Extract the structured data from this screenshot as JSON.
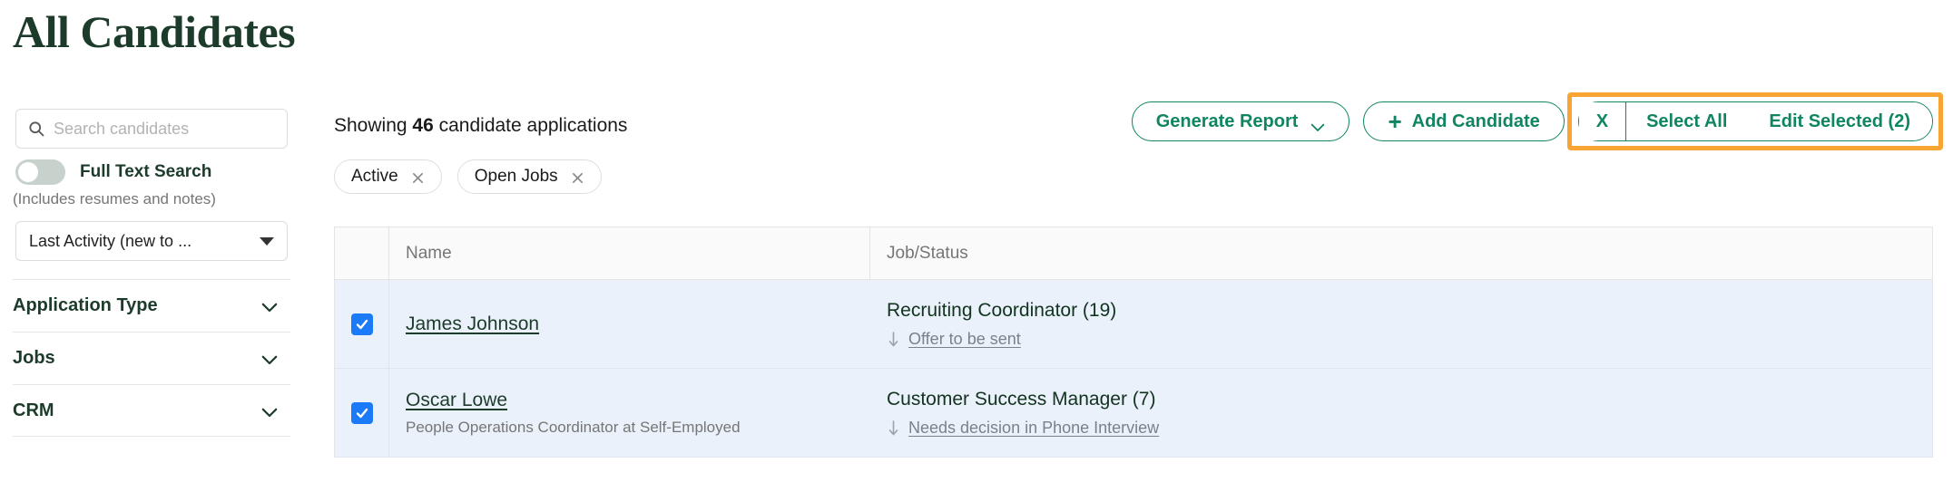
{
  "page_title": "All Candidates",
  "sidebar": {
    "search": {
      "placeholder": "Search candidates",
      "value": "",
      "icon": "search-icon"
    },
    "full_text_toggle": {
      "label": "Full Text Search",
      "sublabel": "(Includes resumes and notes)",
      "state": "off"
    },
    "sort": {
      "selected": "Last Activity (new to ...",
      "icon": "chevron-down-icon"
    },
    "filter_sections": [
      {
        "label": "Application Type",
        "icon": "chevron-down-icon",
        "expanded": false
      },
      {
        "label": "Jobs",
        "icon": "chevron-down-icon",
        "expanded": false
      },
      {
        "label": "CRM",
        "icon": "chevron-down-icon",
        "expanded": false
      }
    ]
  },
  "main": {
    "showing_prefix": "Showing",
    "showing_count": "46",
    "showing_suffix": "candidate applications",
    "actions": {
      "generate_report": "Generate Report",
      "generate_report_icon": "chevron-down-icon",
      "add_candidate": "Add Candidate",
      "add_candidate_icon": "plus-icon",
      "clear_selection": "X",
      "select_all": "Select All",
      "edit_selected": "Edit Selected (2)",
      "highlight_color": "#f9a533",
      "accent_color": "#0f8562"
    },
    "chips": [
      {
        "label": "Active",
        "remove_icon": "close-icon"
      },
      {
        "label": "Open Jobs",
        "remove_icon": "close-icon"
      }
    ],
    "table": {
      "columns": [
        "",
        "Name",
        "Job/Status"
      ],
      "rows": [
        {
          "checked": true,
          "name": "James Johnson",
          "subtitle": "",
          "job": "Recruiting Coordinator (19)",
          "status": "Offer to be sent",
          "status_icon": "arrow-down-icon"
        },
        {
          "checked": true,
          "name": "Oscar Lowe",
          "subtitle": "People Operations Coordinator at Self-Employed",
          "job": "Customer Success Manager (7)",
          "status": "Needs decision in Phone Interview",
          "status_icon": "arrow-down-icon"
        }
      ]
    }
  }
}
